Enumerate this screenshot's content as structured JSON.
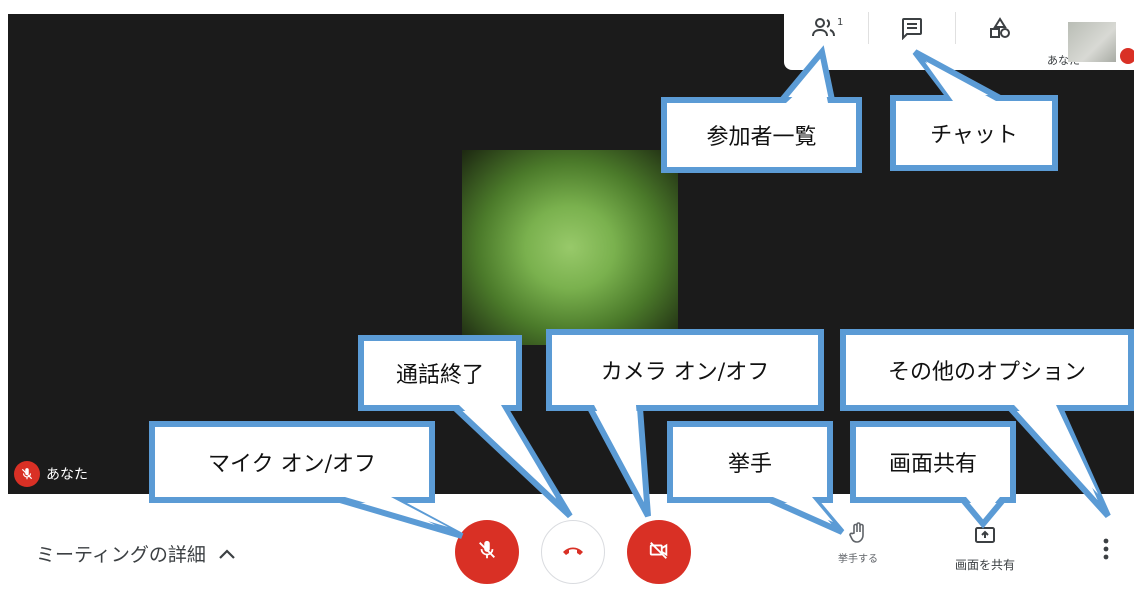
{
  "participant": {
    "name": "あなた"
  },
  "top_panel": {
    "participant_count": "1",
    "self_label": "あなた"
  },
  "bottom_bar": {
    "meeting_details": "ミーティングの詳細",
    "raise_hand": "挙手する",
    "present_screen": "画面を共有"
  },
  "callouts": {
    "participants": "参加者一覧",
    "chat": "チャット",
    "end_call": "通話終了",
    "camera": "カメラ オン/オフ",
    "more_options": "その他のオプション",
    "mic": "マイク オン/オフ",
    "raise_hand": "挙手",
    "screen_share": "画面共有"
  },
  "colors": {
    "mute_red": "#d93025",
    "callout_border": "#5b9bd5",
    "stage_bg": "#1b1b1b"
  },
  "icons": [
    "people-icon",
    "chat-icon",
    "activities-icon",
    "mic-off-icon",
    "call-end-icon",
    "camera-off-icon",
    "hand-icon",
    "present-icon",
    "more-vert-icon"
  ]
}
